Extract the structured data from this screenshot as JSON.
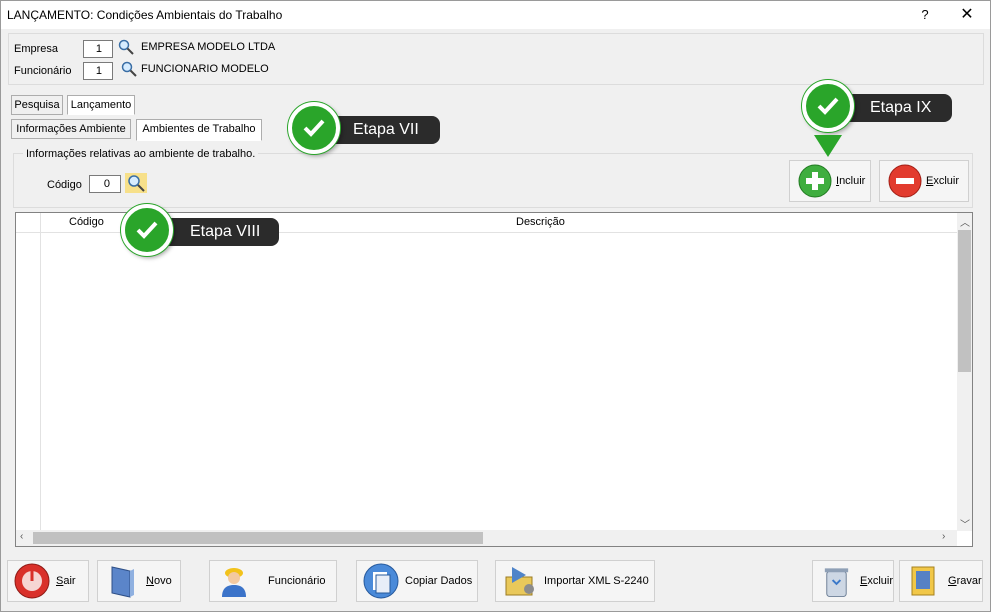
{
  "window": {
    "title": "LANÇAMENTO: Condições Ambientais do Trabalho",
    "help": "?",
    "close": "✕"
  },
  "header": {
    "empresa_label": "Empresa",
    "empresa_code": "1",
    "empresa_name": "EMPRESA MODELO LTDA",
    "funcionario_label": "Funcionário",
    "funcionario_code": "1",
    "funcionario_name": "FUNCIONARIO MODELO"
  },
  "tabs_main": [
    "Pesquisa",
    "Lançamento"
  ],
  "tabs_sub": [
    "Informações Ambiente",
    "Ambientes de Trabalho"
  ],
  "info": {
    "caption": "Informações relativas ao ambiente de trabalho.",
    "codigo_label": "Código",
    "codigo_value": "0",
    "incluir_pre": "",
    "incluir_u": "I",
    "incluir_rest": "ncluir",
    "excluir_u": "E",
    "excluir_rest": "xcluir"
  },
  "grid": {
    "columns": [
      "Código",
      "Descrição"
    ]
  },
  "bottom": [
    {
      "u": "S",
      "rest": "air"
    },
    {
      "u": "N",
      "rest": "ovo"
    },
    {
      "label": "Funcionário"
    },
    {
      "label": "Copiar Dados"
    },
    {
      "label": "Importar XML S-2240"
    },
    {
      "u": "E",
      "rest": "xcluir"
    },
    {
      "u": "G",
      "rest": "ravar"
    }
  ],
  "callouts": [
    "Etapa VII",
    "Etapa VIII",
    "Etapa IX"
  ],
  "colors": {
    "accent_green": "#2aa52a",
    "callout_bg": "#2b2b2b"
  }
}
